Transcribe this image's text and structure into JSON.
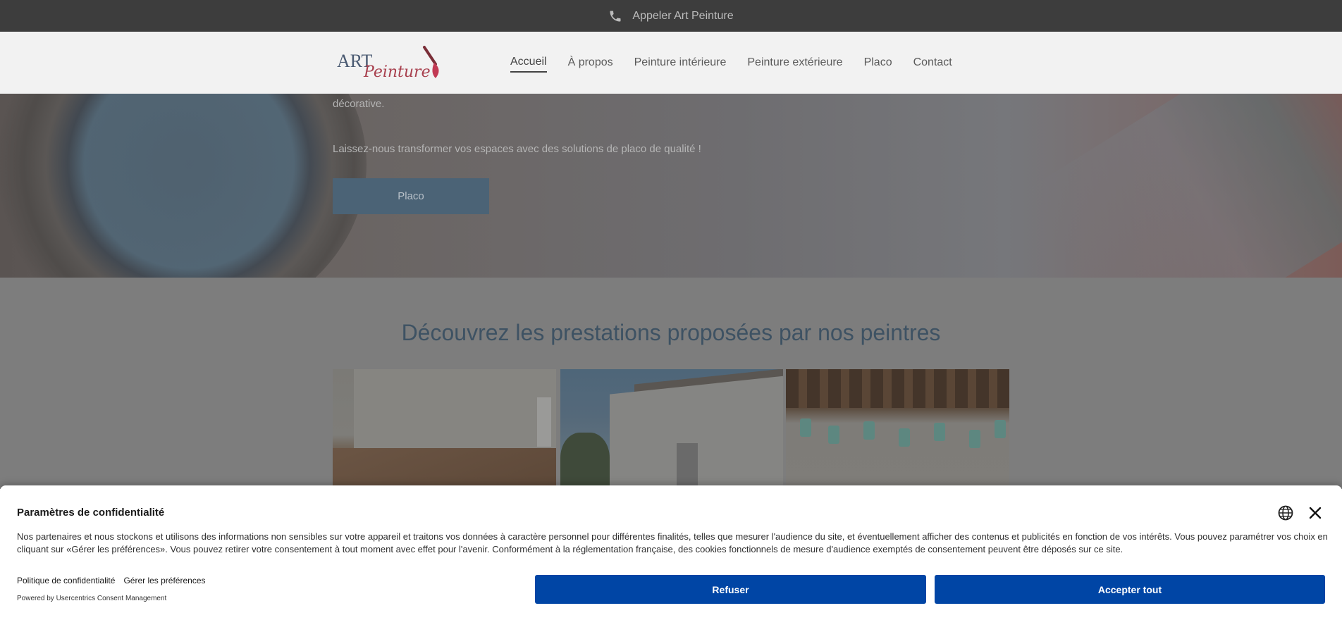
{
  "topbar": {
    "call_label": "Appeler Art Peinture",
    "icon": "phone-icon"
  },
  "header": {
    "logo": {
      "text_art": "ART",
      "text_peinture": "Peinture",
      "icon": "paintbrush-icon"
    },
    "nav": [
      {
        "label": "Accueil",
        "active": true
      },
      {
        "label": "À propos",
        "active": false
      },
      {
        "label": "Peinture intérieure",
        "active": false
      },
      {
        "label": "Peinture extérieure",
        "active": false
      },
      {
        "label": "Placo",
        "active": false
      },
      {
        "label": "Contact",
        "active": false
      }
    ]
  },
  "hero": {
    "text_partial": "décorative.",
    "text_cta_intro": "Laissez-nous transformer vos espaces avec des solutions de placo de qualité !",
    "button_label": "Placo"
  },
  "services": {
    "heading": "Découvrez les prestations proposées par nos peintres"
  },
  "consent": {
    "title": "Paramètres de confidentialité",
    "body": "Nos partenaires et nous stockons et utilisons des informations non sensibles sur votre appareil et traitons vos données à caractère personnel pour différentes finalités, telles que mesurer l'audience du site, et éventuellement afficher des contenus et publicités en fonction de vos intérêts. Vous pouvez paramétrer vos choix en cliquant sur «Gérer les préférences». Vous pouvez retirer votre consentement à tout moment avec effet pour l'avenir. Conformément à la réglementation française, des cookies fonctionnels de mesure d'audience exemptés de consentement peuvent être déposés sur ce site.",
    "link_privacy": "Politique de confidentialité",
    "link_manage": "Gérer les préférences",
    "powered_by": "Powered by Usercentrics Consent Management",
    "refuse_label": "Refuser",
    "accept_label": "Accepter tout",
    "button_color": "#0045a5"
  }
}
